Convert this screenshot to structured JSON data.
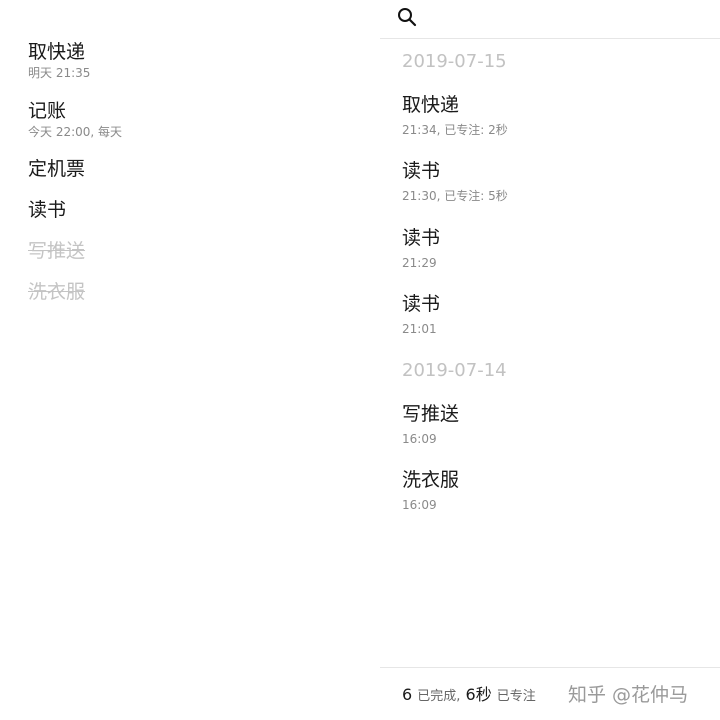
{
  "todo_list": {
    "items": [
      {
        "title": "取快递",
        "subtitle": "明天 21:35"
      },
      {
        "title": "记账",
        "subtitle": "今天 22:00, 每天"
      },
      {
        "title": "定机票"
      },
      {
        "title": "读书"
      },
      {
        "title": "写推送",
        "completed": true
      },
      {
        "title": "洗衣服",
        "completed": true
      }
    ]
  },
  "history": {
    "search_icon": "search-icon",
    "groups": [
      {
        "date": "2019-07-15",
        "entries": [
          {
            "title": "取快递",
            "detail": "21:34, 已专注: 2秒"
          },
          {
            "title": "读书",
            "detail": "21:30, 已专注: 5秒"
          },
          {
            "title": "读书",
            "detail": "21:29"
          },
          {
            "title": "读书",
            "detail": "21:01"
          }
        ]
      },
      {
        "date": "2019-07-14",
        "entries": [
          {
            "title": "写推送",
            "detail": "16:09"
          },
          {
            "title": "洗衣服",
            "detail": "16:09"
          }
        ]
      }
    ],
    "footer": {
      "completed_count": "6",
      "completed_label": "已完成,",
      "focus_time": "6秒",
      "focus_label": "已专注"
    }
  },
  "watermark": "知乎 @花仲马"
}
